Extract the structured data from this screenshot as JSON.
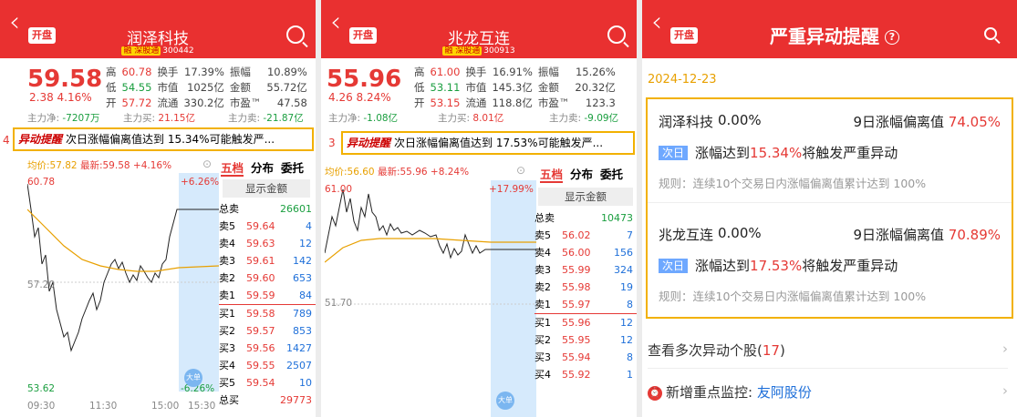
{
  "p1": {
    "name": "润泽科技",
    "sub_tag": "融 深股通",
    "code": "300442",
    "price": "59.58",
    "change": "2.38",
    "pct": "4.16%",
    "q": [
      [
        "高",
        "60.78",
        "换手",
        "17.39%",
        "振幅",
        "10.89%"
      ],
      [
        "低",
        "54.55",
        "市值",
        "1025亿",
        "金额",
        "55.72亿"
      ],
      [
        "开",
        "57.72",
        "流通",
        "330.2亿",
        "市盈™",
        "47.58"
      ]
    ],
    "flow_net_label": "主力净:",
    "flow_net": "-7207万",
    "flow_buy_label": "主力买:",
    "flow_buy": "21.15亿",
    "flow_sell_label": "主力卖:",
    "flow_sell": "-21.87亿",
    "alert_num": "4",
    "alert_tag": "异动提醒",
    "alert_text": "次日涨幅偏离值达到 15.34%可能触发严...",
    "avg_label": "均价:57.82",
    "last_label": "最新:59.58",
    "last_pct": "+4.16%",
    "y_high": "60.78",
    "y_mid": "57.20",
    "y_low": "53.62",
    "pct_high": "+6.26%",
    "pct_low": "-6.26%",
    "x_ticks": [
      "09:30",
      "11:30",
      "15:00",
      "15:30"
    ],
    "big_order": "大单",
    "tabs": [
      "五档",
      "分布",
      "委托"
    ],
    "amount_btn": "显示金额",
    "total_sell_label": "总卖",
    "total_sell": "26601",
    "total_buy_label": "总买",
    "total_buy": "29773",
    "sells": [
      [
        "卖5",
        "59.64",
        "4"
      ],
      [
        "卖4",
        "59.63",
        "12"
      ],
      [
        "卖3",
        "59.61",
        "142"
      ],
      [
        "卖2",
        "59.60",
        "653"
      ],
      [
        "卖1",
        "59.59",
        "84"
      ]
    ],
    "buys": [
      [
        "买1",
        "59.58",
        "789"
      ],
      [
        "买2",
        "59.57",
        "853"
      ],
      [
        "买3",
        "59.56",
        "1427"
      ],
      [
        "买4",
        "59.55",
        "2507"
      ],
      [
        "买5",
        "59.54",
        "10"
      ]
    ]
  },
  "p2": {
    "name": "兆龙互连",
    "sub_tag": "融 深股通",
    "code": "300913",
    "price": "55.96",
    "change": "4.26",
    "pct": "8.24%",
    "q": [
      [
        "高",
        "61.00",
        "换手",
        "16.91%",
        "振幅",
        "15.26%"
      ],
      [
        "低",
        "53.11",
        "市值",
        "145.3亿",
        "金额",
        "20.32亿"
      ],
      [
        "开",
        "53.15",
        "流通",
        "118.8亿",
        "市盈™",
        "123.3"
      ]
    ],
    "flow_net_label": "主力净:",
    "flow_net": "-1.08亿",
    "flow_buy_label": "主力买:",
    "flow_buy": "8.01亿",
    "flow_sell_label": "主力卖:",
    "flow_sell": "-9.09亿",
    "alert_num": "3",
    "alert_tag": "异动提醒",
    "alert_text": "次日涨幅偏离值达到 17.53%可能触发严...",
    "avg_label": "均价:56.60",
    "last_label": "最新:55.96",
    "last_pct": "+8.24%",
    "y_high": "61.00",
    "y_low": "51.70",
    "pct_high": "+17.99%",
    "big_order": "大单",
    "tabs": [
      "五档",
      "分布",
      "委托"
    ],
    "amount_btn": "显示金额",
    "total_sell_label": "总卖",
    "total_sell": "10473",
    "sells": [
      [
        "卖5",
        "56.02",
        "7"
      ],
      [
        "卖4",
        "56.00",
        "156"
      ],
      [
        "卖3",
        "55.99",
        "324"
      ],
      [
        "卖2",
        "55.98",
        "19"
      ],
      [
        "卖1",
        "55.97",
        "8"
      ]
    ],
    "buys": [
      [
        "买1",
        "55.96",
        "12"
      ],
      [
        "买2",
        "55.95",
        "12"
      ],
      [
        "买3",
        "55.94",
        "8"
      ],
      [
        "买4",
        "55.92",
        "1"
      ]
    ]
  },
  "p3": {
    "title": "严重异动提醒",
    "info": "?",
    "date": "2024-12-23",
    "cards": [
      {
        "name": "润泽科技",
        "pct": "0.00%",
        "dev_label": "9日涨幅偏离值",
        "dev": "74.05%",
        "day": "次日",
        "lvl_pre": "涨幅达到",
        "lvl_val": "15.34%",
        "lvl_post": "将触发严重异动",
        "rule": "规则：连续10个交易日内涨幅偏离值累计达到 100%"
      },
      {
        "name": "兆龙互连",
        "pct": "0.00%",
        "dev_label": "9日涨幅偏离值",
        "dev": "70.89%",
        "day": "次日",
        "lvl_pre": "涨幅达到",
        "lvl_val": "17.53%",
        "lvl_post": "将触发严重异动",
        "rule": "规则：连续10个交易日内涨幅偏离值累计达到 100%"
      }
    ],
    "more_label": "查看多次异动个股(",
    "more_count": "17",
    "more_close": ")",
    "monitor_label": "新增重点监控:",
    "monitor_stock": "友阿股份"
  },
  "icons": {
    "back": "back-chevron-icon",
    "search": "search-icon",
    "info": "info-circle-icon",
    "alarm": "alarm-icon",
    "arrow": "chevron-right-icon",
    "settings": "settings-icon"
  },
  "colors": {
    "header": "#e93030",
    "up": "#e53935",
    "down": "#1a9e3f",
    "alert_border": "#f2b100"
  }
}
